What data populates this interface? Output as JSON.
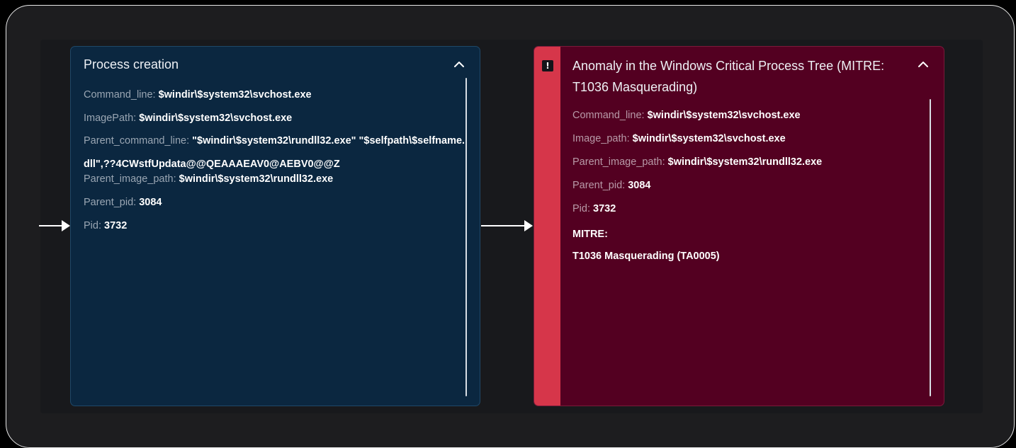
{
  "process_card": {
    "title": "Process creation",
    "fields": {
      "command_line": {
        "key": "Command_line:",
        "value": "$windir\\$system32\\svchost.exe"
      },
      "image_path": {
        "key": "ImagePath:",
        "value": "$windir\\$system32\\svchost.exe"
      },
      "parent_command_line": {
        "key": "Parent_command_line:",
        "value": "\"$windir\\$system32\\rundll32.exe\" \"$selfpath\\$selfname.dll\",??4CWstfUpdata@@QEAAAEAV0@AEBV0@@Z"
      },
      "parent_image_path": {
        "key": "Parent_image_path:",
        "value": "$windir\\$system32\\rundll32.exe"
      },
      "parent_pid": {
        "key": "Parent_pid:",
        "value": "3084"
      },
      "pid": {
        "key": "Pid:",
        "value": "3732"
      }
    }
  },
  "anomaly_card": {
    "title": "Anomaly in the Windows Critical Process Tree (MITRE: T1036 Masquerading)",
    "alert_glyph": "!",
    "fields": {
      "command_line": {
        "key": "Command_line:",
        "value": "$windir\\$system32\\svchost.exe"
      },
      "image_path": {
        "key": "Image_path:",
        "value": "$windir\\$system32\\svchost.exe"
      },
      "parent_image_path": {
        "key": "Parent_image_path:",
        "value": "$windir\\$system32\\rundll32.exe"
      },
      "parent_pid": {
        "key": "Parent_pid:",
        "value": "3084"
      },
      "pid": {
        "key": "Pid:",
        "value": "3732"
      }
    },
    "mitre_label": "MITRE:",
    "mitre_value": "T1036 Masquerading (TA0005)"
  },
  "icons": {
    "collapse": "chevron-up-icon",
    "alert": "exclamation-square-icon",
    "flow": "arrow-right-icon"
  },
  "colors": {
    "process_card_bg": "#0b2740",
    "anomaly_card_bg": "#530021",
    "alert_stripe": "#d6364a"
  }
}
